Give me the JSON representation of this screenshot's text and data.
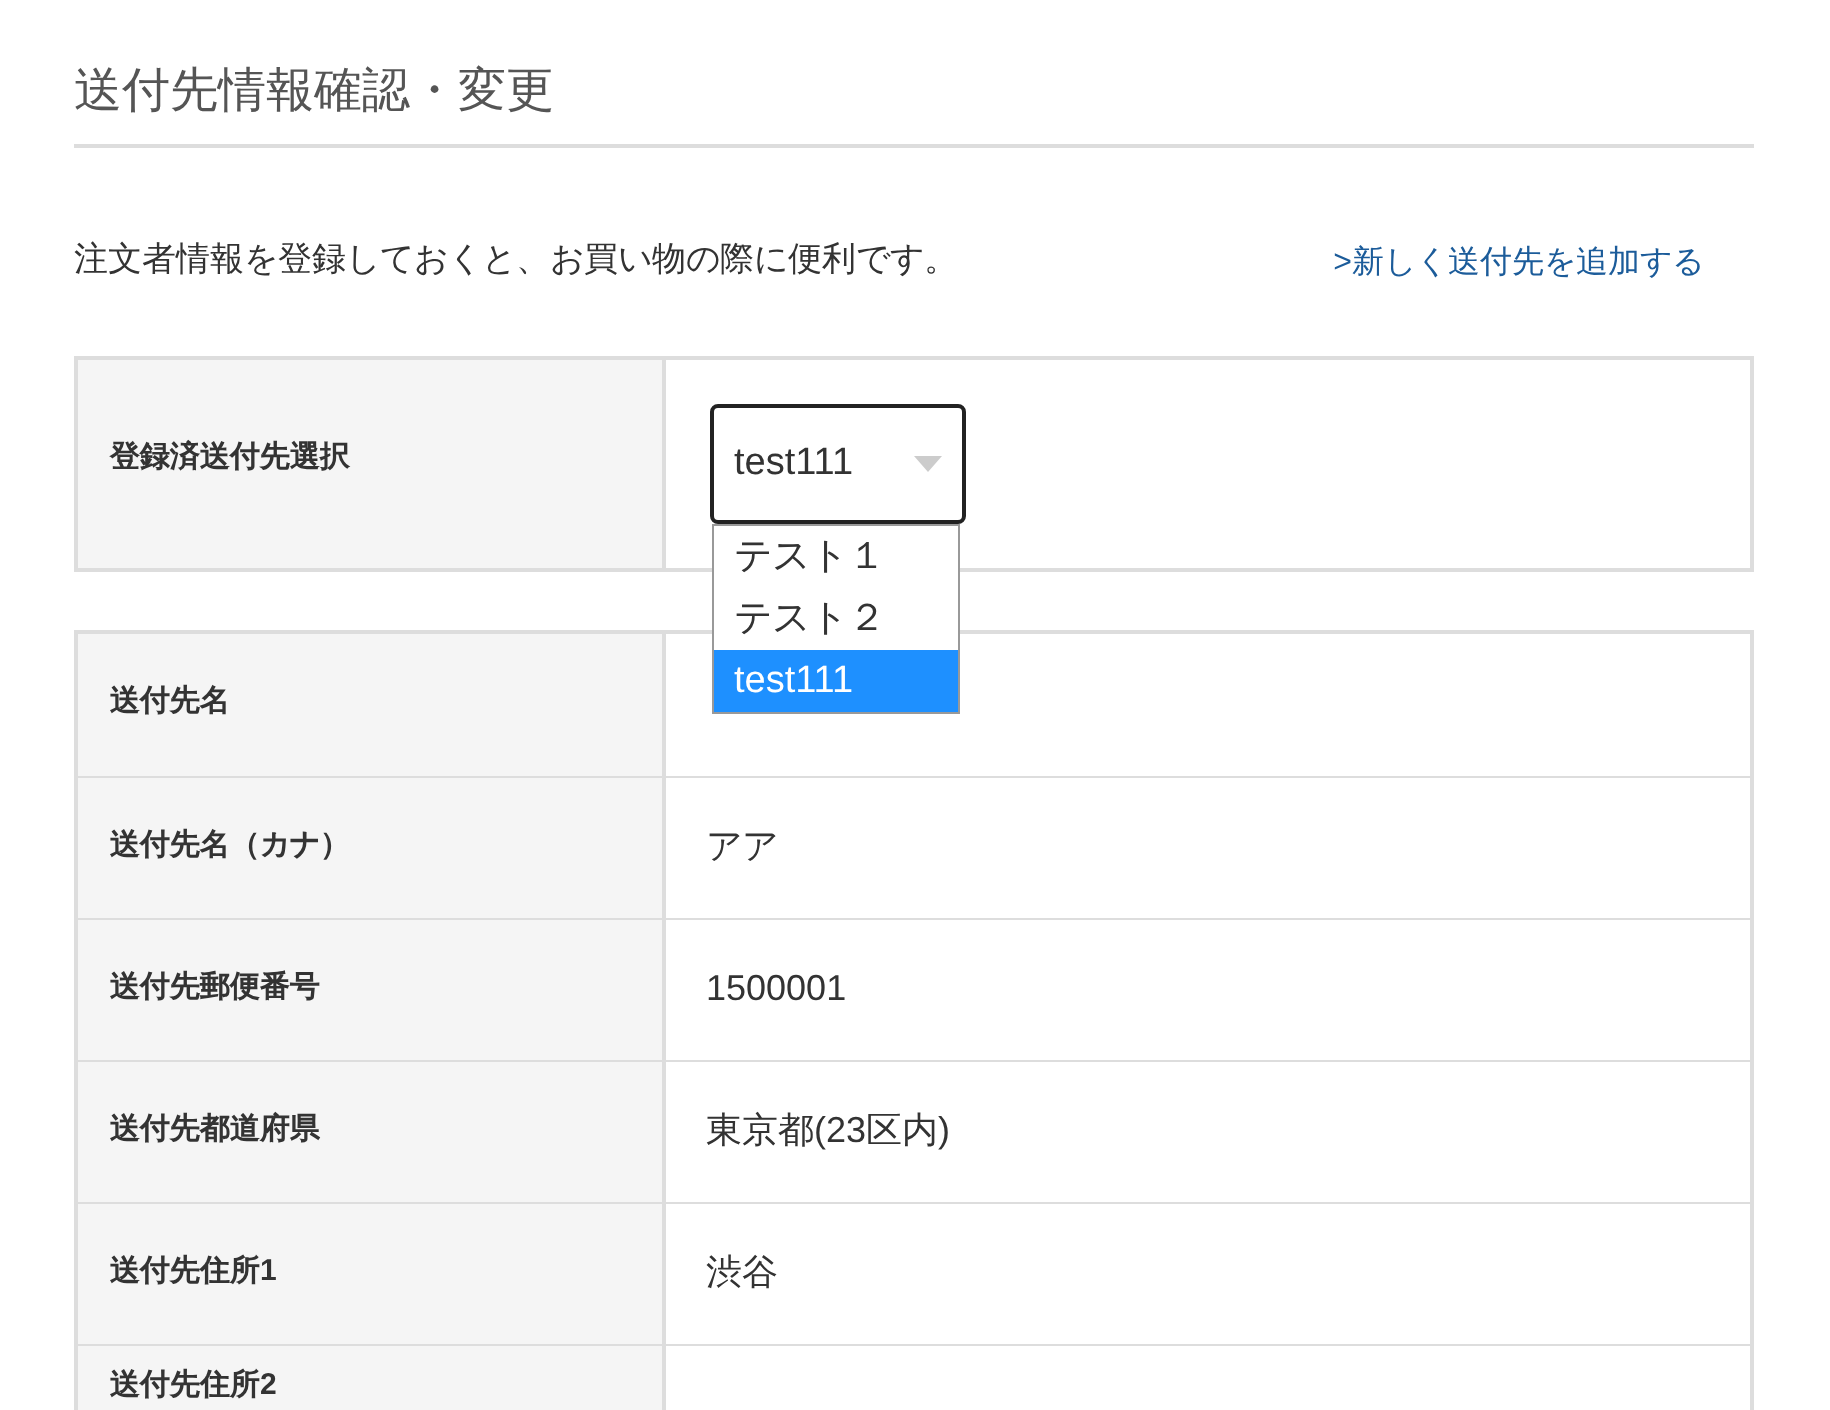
{
  "title": "送付先情報確認・変更",
  "description": "注文者情報を登録しておくと、お買い物の際に便利です。",
  "add_link": ">新しく送付先を追加する",
  "selector": {
    "label": "登録済送付先選択",
    "value": "test111",
    "expanded": true,
    "options": [
      {
        "label": "テスト１",
        "selected": false
      },
      {
        "label": "テスト２",
        "selected": false
      },
      {
        "label": "test111",
        "selected": true
      }
    ]
  },
  "fields": [
    {
      "label": "送付先名"
    },
    {
      "label": "送付先名（カナ）",
      "value": "アア"
    },
    {
      "label": "送付先郵便番号",
      "value": "1500001"
    },
    {
      "label": "送付先都道府県",
      "value": "東京都(23区内)"
    },
    {
      "label": "送付先住所1",
      "value": "渋谷"
    },
    {
      "label": "送付先住所2"
    }
  ]
}
